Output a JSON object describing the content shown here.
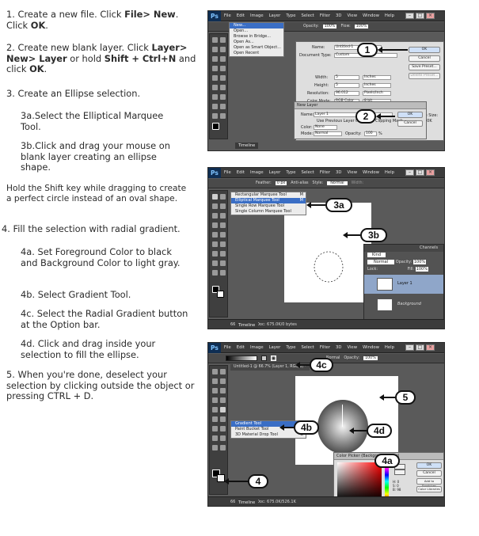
{
  "steps": {
    "s1": {
      "n": "1.",
      "a": "Create a new file. Click ",
      "b": "File> New",
      "c": ". Click ",
      "d": "OK",
      "e": "."
    },
    "s2": {
      "n": "2.",
      "a": "Create new blank layer. Click ",
      "b": "Layer> New> Layer",
      "c": " or hold ",
      "d": "Shift + Ctrl+N",
      "e": " and click ",
      "f": "OK",
      "g": "."
    },
    "s3": {
      "n": "3.",
      "t": "Create an Ellipse selection."
    },
    "s3a": "3a.Select the Elliptical Marquee Tool.",
    "s3b": "3b.Click and drag your mouse on blank layer creating an ellipse shape.",
    "note": "Hold the Shift key while dragging to create a perfect circle instead of an oval shape.",
    "s4": "4. Fill the selection with radial gradient.",
    "s4a": "4a. Set Foreground Color to black and Background Color to light gray.",
    "s4b": "4b. Select Gradient Tool.",
    "s4c": "4c. Select the Radial Gradient button at the Option bar.",
    "s4d": "4d. Click and drag inside your selection to fill the ellipse.",
    "s5": "5. When you're done, deselect your selection by clicking outside the object or pressing CTRL + D."
  },
  "app": {
    "logo": "Ps",
    "menu": [
      "File",
      "Edit",
      "Image",
      "Layer",
      "Type",
      "Select",
      "Filter",
      "3D",
      "View",
      "Window",
      "Help"
    ],
    "minimize": "–",
    "maximize": "□",
    "close": "×"
  },
  "shot1": {
    "opacity_label": "Opacity:",
    "opacity": "100%",
    "flow_label": "Flow:",
    "flow": "100%",
    "file_menu": [
      "New...",
      "Open...",
      "Browse in Bridge...",
      "Open As...",
      "Open as Smart Object...",
      "Open Recent"
    ],
    "new_dlg": {
      "name_label": "Name:",
      "name": "Untitled-1",
      "type_label": "Document Type:",
      "type": "Custom",
      "width_label": "Width:",
      "width": "5",
      "width_unit": "Inches",
      "height_label": "Height:",
      "height": "5",
      "height_unit": "Inches",
      "res_label": "Resolution:",
      "res": "96.012",
      "res_unit": "Pixels/Inch",
      "mode_label": "Color Mode:",
      "mode": "RGB Color",
      "depth": "8 bit",
      "ok": "OK",
      "cancel": "Cancel",
      "save": "Save Preset...",
      "delete": "Delete Preset...",
      "size_label": "Image Size:",
      "size": "675.0K"
    },
    "layer_dlg": {
      "title": "New Layer",
      "name_label": "Name:",
      "name": "Layer 1",
      "use_prev": "Use Previous Layer to Create Clipping Mask",
      "color_label": "Color:",
      "color": "None",
      "mode_label": "Mode:",
      "mode": "Normal",
      "opacity_label": "Opacity:",
      "opacity": "100",
      "pct": "%",
      "neutral": "(No neutral color exists for Normal mode.)",
      "ok": "OK",
      "cancel": "Cancel"
    },
    "timeline": "Timeline",
    "b1": "1",
    "b2": "2"
  },
  "shot2": {
    "feather_label": "Feather:",
    "feather": "0 px",
    "anti_alias": "Anti-alias",
    "style_label": "Style:",
    "style": "Normal",
    "width_label": "Width:",
    "marquee_menu": [
      {
        "label": "Rectangular Marquee Tool",
        "key": "M"
      },
      {
        "label": "Elliptical Marquee Tool",
        "key": "M"
      },
      {
        "label": "Single Row Marquee Tool",
        "key": ""
      },
      {
        "label": "Single Column Marquee Tool",
        "key": ""
      }
    ],
    "channels": "Channels",
    "kind": "Kind",
    "normal": "Normal",
    "opacity_label": "Opacity:",
    "opacity": "100%",
    "lock_label": "Lock:",
    "fill_label": "Fill:",
    "fill": "100%",
    "layer1": "Layer 1",
    "background": "Background",
    "zoom": "66.67%",
    "doc": "Doc: 675.0K/0 bytes",
    "timeline": "Timeline",
    "b3a": "3a",
    "b3b": "3b"
  },
  "shot3": {
    "doc_title": "Untitled-1 @ 66.7% (Layer 1, RGB/8) *",
    "mode": "Normal",
    "opacity_label": "Opacity:",
    "opacity": "100%",
    "gradient_menu": [
      {
        "label": "Gradient Tool",
        "key": "G"
      },
      {
        "label": "Paint Bucket Tool",
        "key": "G"
      },
      {
        "label": "3D Material Drop Tool",
        "key": "G"
      }
    ],
    "picker": {
      "title": "Color Picker (Background Color)",
      "ok": "OK",
      "cancel": "Cancel",
      "add": "Add to Swatches",
      "libs": "Color Libraries",
      "new_label": "new",
      "current_label": "current",
      "web": "Only Web Colors",
      "fields": [
        "H: 0",
        "S: 0",
        "B: 98",
        "R: 242",
        "G: 242",
        "B: 242"
      ]
    },
    "zoom": "66.67%",
    "doc": "Doc: 675.0K/526.1K",
    "timeline": "Timeline",
    "b4a": "4a",
    "b4b": "4b",
    "b4c": "4c",
    "b4d": "4d",
    "b4": "4",
    "b5": "5"
  }
}
